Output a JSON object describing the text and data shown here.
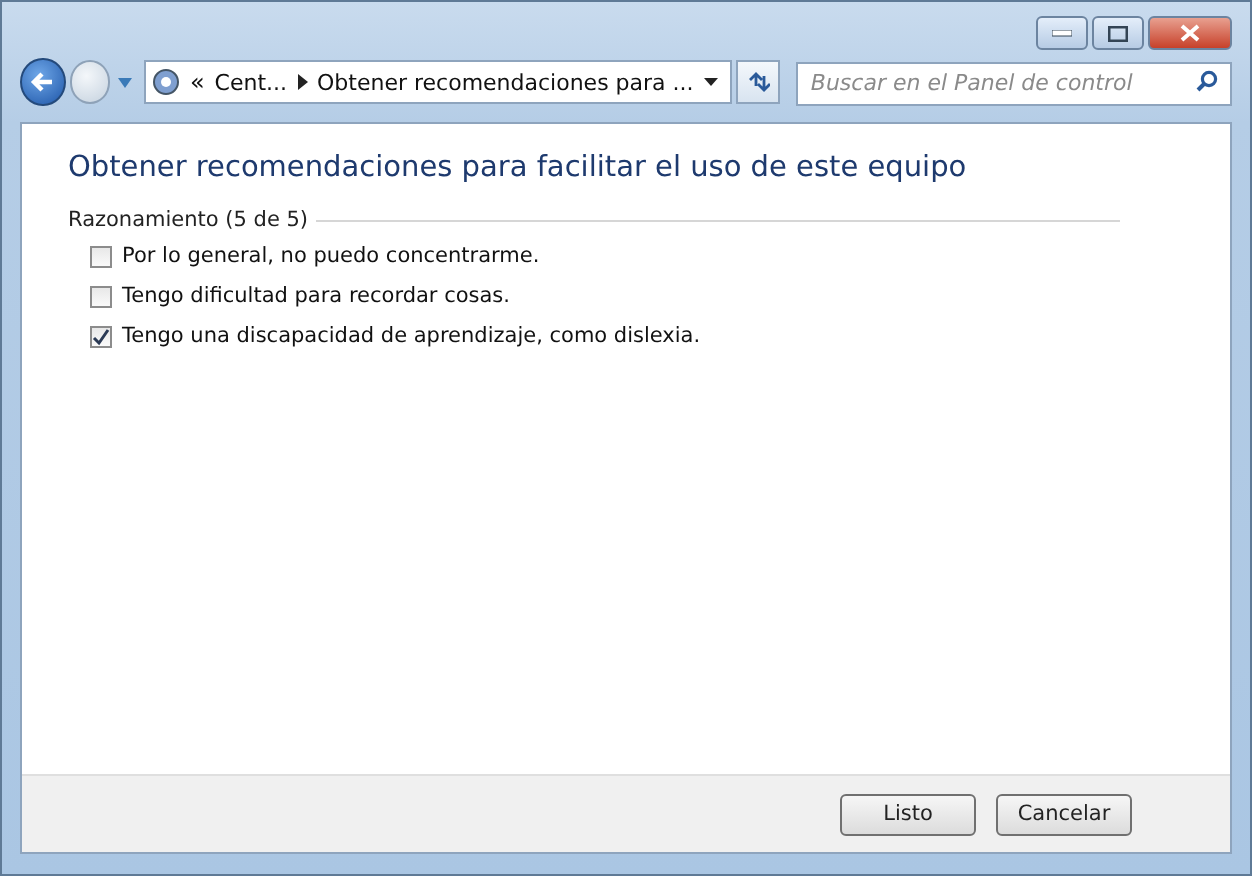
{
  "address_bar": {
    "overflow": "«",
    "crumbs": [
      "Cent...",
      "Obtener recomendaciones para ..."
    ]
  },
  "search": {
    "placeholder": "Buscar en el Panel de control"
  },
  "heading": "Obtener recomendaciones para facilitar el uso de este equipo",
  "group": {
    "title": "Razonamiento (5 de 5)",
    "options": [
      {
        "label": "Por lo general, no puedo concentrarme.",
        "checked": false
      },
      {
        "label": "Tengo dificultad para recordar cosas.",
        "checked": false
      },
      {
        "label": "Tengo una discapacidad de aprendizaje, como dislexia.",
        "checked": true
      }
    ]
  },
  "buttons": [
    "Listo",
    "Cancelar"
  ]
}
